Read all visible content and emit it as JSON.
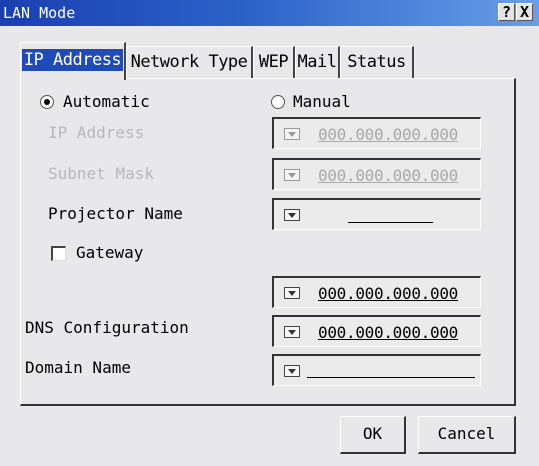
{
  "window": {
    "title": "LAN Mode",
    "help_label": "?",
    "close_label": "X"
  },
  "tabs": [
    {
      "label": "IP Address",
      "active": true
    },
    {
      "label": "Network Type"
    },
    {
      "label": "WEP"
    },
    {
      "label": "Mail"
    },
    {
      "label": "Status"
    }
  ],
  "mode": {
    "automatic_label": "Automatic",
    "manual_label": "Manual",
    "selected": "Automatic"
  },
  "fields": {
    "ip_address": {
      "label": "IP Address",
      "value": "000.000.000.000",
      "enabled": false
    },
    "subnet_mask": {
      "label": "Subnet Mask",
      "value": "000.000.000.000",
      "enabled": false
    },
    "projector_name": {
      "label": "Projector Name",
      "value": ""
    },
    "gateway": {
      "label": "Gateway",
      "checked": false,
      "value": "000.000.000.000"
    },
    "dns_configuration": {
      "label": "DNS Configuration",
      "value": "000.000.000.000"
    },
    "domain_name": {
      "label": "Domain Name",
      "value": ""
    }
  },
  "buttons": {
    "ok_label": "OK",
    "cancel_label": "Cancel"
  },
  "colors": {
    "title_bar": "#1f4bb8",
    "active_tab_highlight": "#1f4bb8",
    "disabled_text": "#b8b8b8"
  }
}
